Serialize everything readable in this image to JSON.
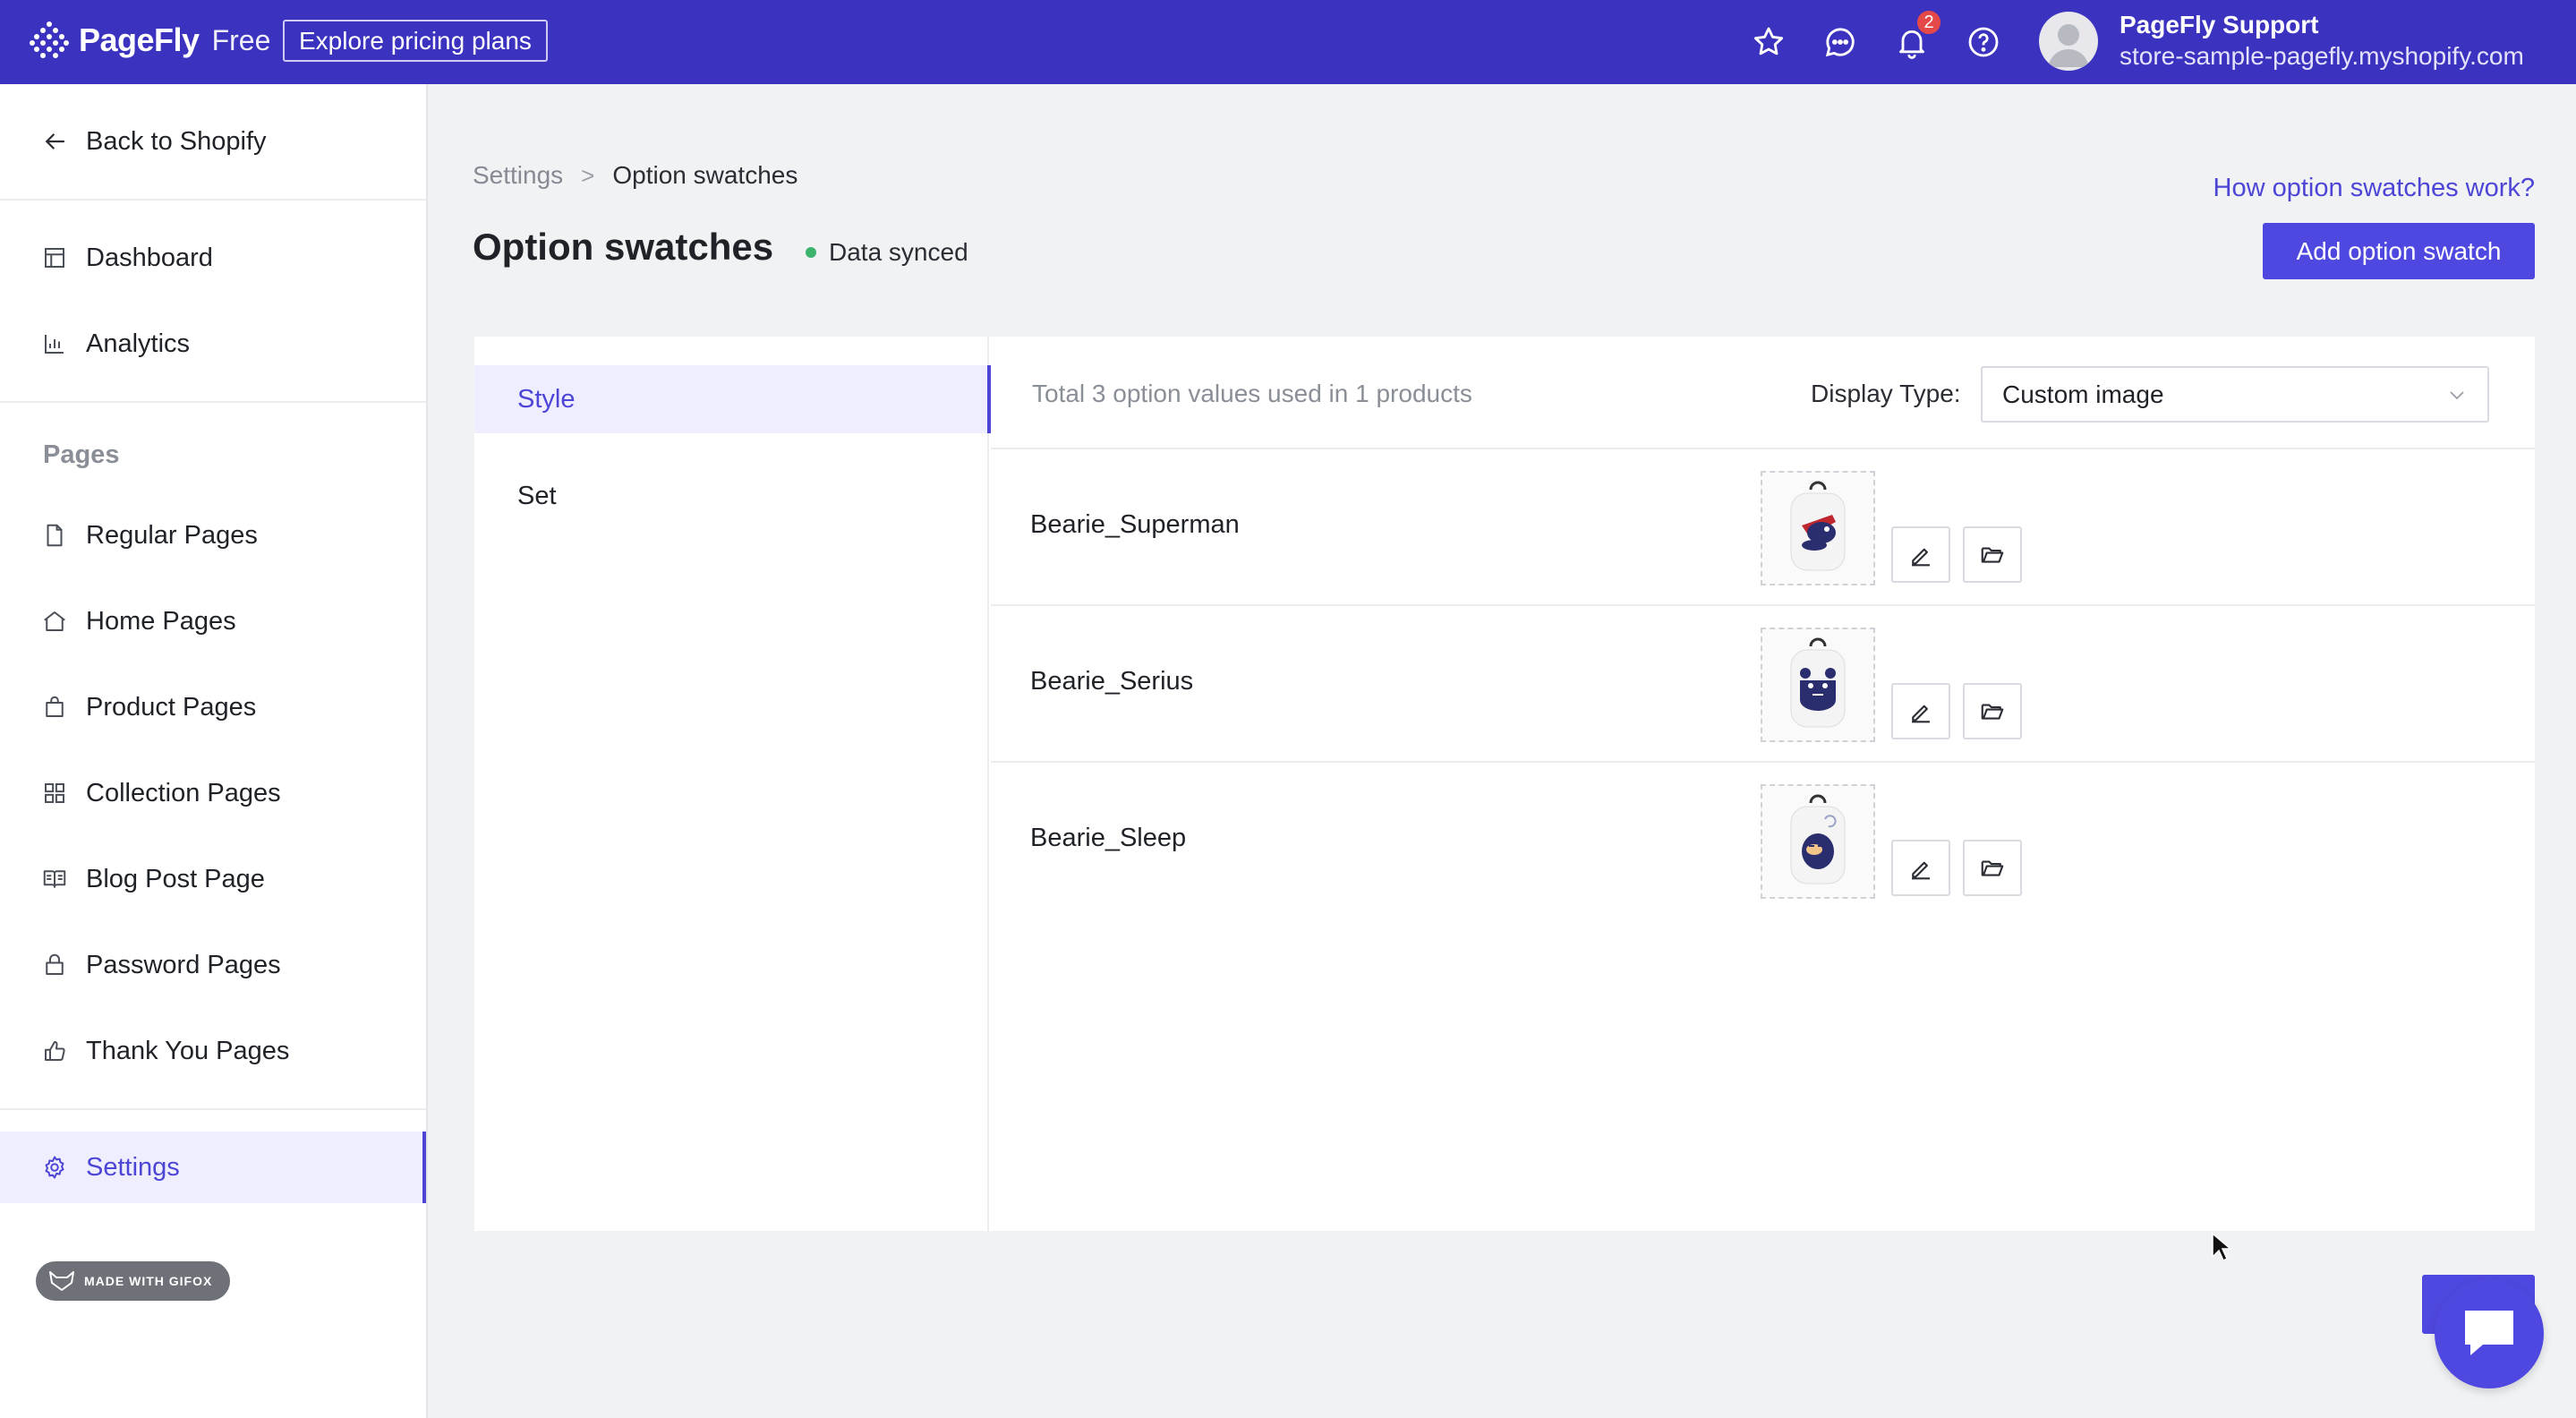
{
  "topbar": {
    "logo_text": "PageFly",
    "plan_text": "Free",
    "pricing_label": "Explore pricing plans",
    "icons": [
      "star-icon",
      "chat-icon",
      "bell-icon",
      "help-icon"
    ],
    "notification_count": "2",
    "user_name": "PageFly Support",
    "user_store": "store-sample-pagefly.myshopify.com"
  },
  "sidebar": {
    "back_label": "Back to Shopify",
    "main_items": [
      {
        "label": "Dashboard",
        "icon": "dashboard-icon"
      },
      {
        "label": "Analytics",
        "icon": "analytics-icon"
      }
    ],
    "pages_heading": "Pages",
    "page_items": [
      {
        "label": "Regular Pages",
        "icon": "file-icon"
      },
      {
        "label": "Home Pages",
        "icon": "home-icon"
      },
      {
        "label": "Product Pages",
        "icon": "bag-icon"
      },
      {
        "label": "Collection Pages",
        "icon": "grid-icon"
      },
      {
        "label": "Blog Post Page",
        "icon": "book-icon"
      },
      {
        "label": "Password Pages",
        "icon": "lock-icon"
      },
      {
        "label": "Thank You Pages",
        "icon": "thumbs-up-icon"
      }
    ],
    "settings_label": "Settings",
    "gifox_label": "MADE WITH GIFOX"
  },
  "header": {
    "breadcrumb_root": "Settings",
    "breadcrumb_current": "Option swatches",
    "title": "Option swatches",
    "sync_status": "Data synced",
    "help_link": "How option swatches work?",
    "add_button": "Add option swatch"
  },
  "panel": {
    "tabs": [
      {
        "label": "Style",
        "active": true
      },
      {
        "label": "Set",
        "active": false
      }
    ],
    "total_text": "Total 3 option values used in 1 products",
    "display_type_label": "Display Type:",
    "display_type_value": "Custom image",
    "swatches": [
      {
        "name": "Bearie_Superman"
      },
      {
        "name": "Bearie_Serius"
      },
      {
        "name": "Bearie_Sleep"
      }
    ]
  },
  "colors": {
    "brand": "#3b32bf",
    "accent": "#4f48e0",
    "sync_green": "#3cb46e",
    "badge_red": "#e54848"
  }
}
